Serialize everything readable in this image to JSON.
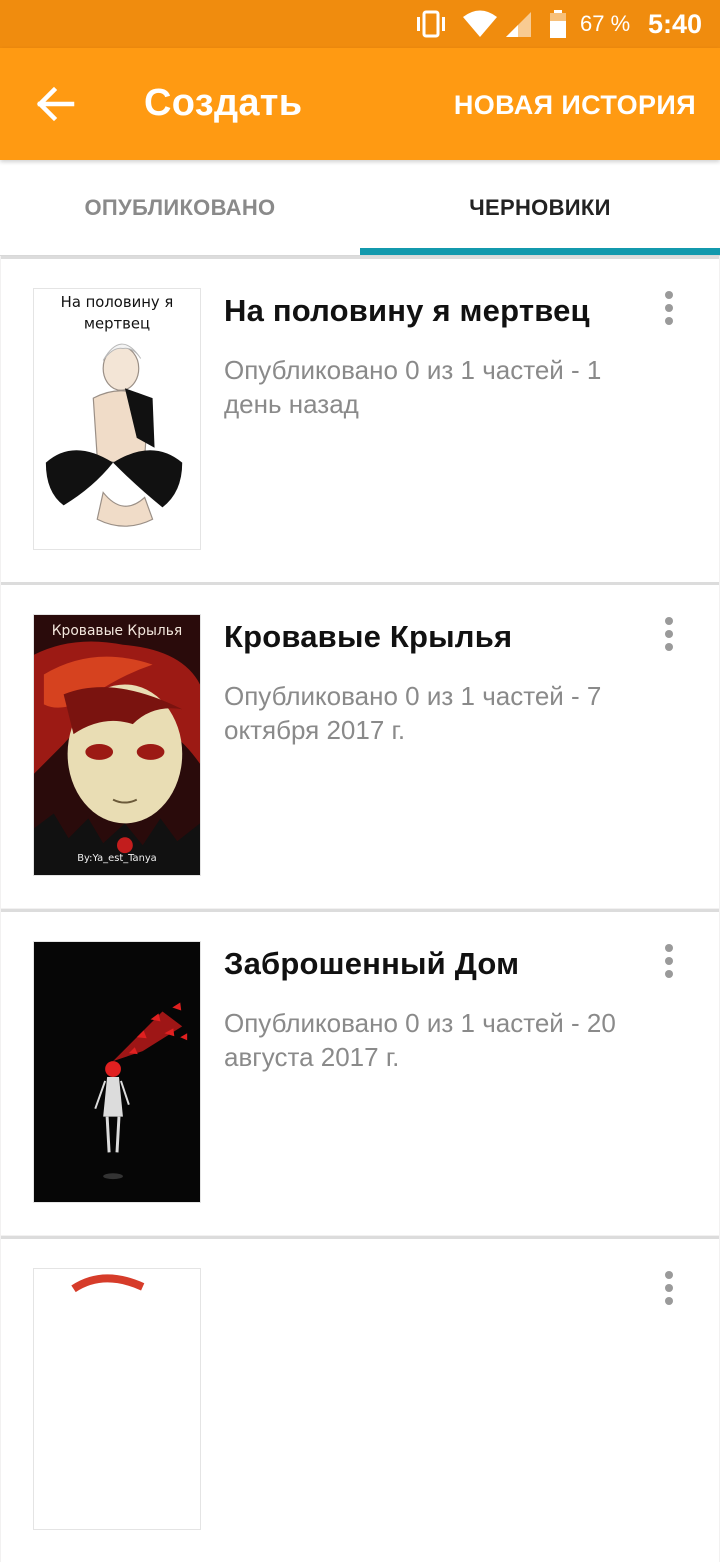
{
  "status_bar": {
    "battery_percent": "67 %",
    "time": "5:40",
    "icons": [
      "vibrate-icon",
      "wifi-icon",
      "signal-icon",
      "battery-icon"
    ]
  },
  "app_bar": {
    "title": "Создать",
    "action_label": "НОВАЯ ИСТОРИЯ",
    "background": "#ff9a12"
  },
  "tabs": [
    {
      "label": "ОПУБЛИКОВАНО",
      "selected": false
    },
    {
      "label": "ЧЕРНОВИКИ",
      "selected": true
    }
  ],
  "accent_color": "#1399ad",
  "stories": [
    {
      "title": "На половину я мертвец",
      "meta": "Опубликовано 0 из 1 частей - 1 день назад",
      "cover_text": "На половину я мертвец"
    },
    {
      "title": "Кровавые Крылья",
      "meta": "Опубликовано 0 из 1 частей - 7 октября 2017 г.",
      "cover_text": "Кровавые Крылья",
      "cover_credit": "By:Ya_est_Tanya"
    },
    {
      "title": "Заброшенный Дом",
      "meta": "Опубликовано 0 из 1 частей - 20 августа 2017 г."
    },
    {
      "title": "",
      "meta": ""
    }
  ]
}
